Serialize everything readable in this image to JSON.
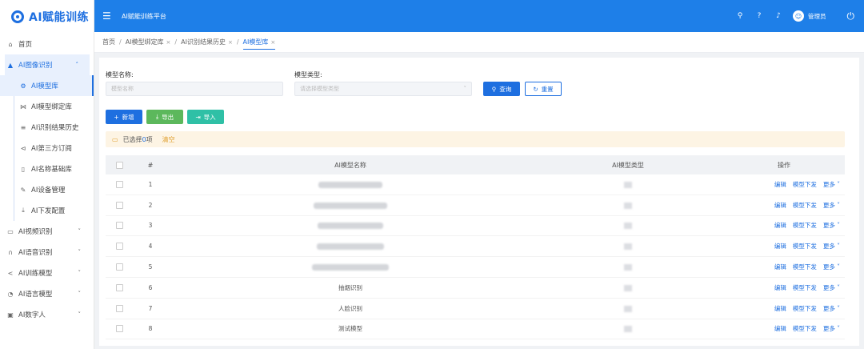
{
  "app": {
    "logo": "AI赋能训练",
    "platform": "AI赋能训练平台"
  },
  "header": {
    "user": "管理员"
  },
  "sidebar": {
    "home": "首页",
    "group": "AI图像识别",
    "subitems": [
      {
        "label": "AI模型库",
        "icon": "gear-icon",
        "active": true
      },
      {
        "label": "AI模型绑定库",
        "icon": "bind-icon"
      },
      {
        "label": "AI识别结果历史",
        "icon": "list-icon"
      },
      {
        "label": "AI第三方订阅",
        "icon": "subscribe-icon"
      },
      {
        "label": "AI名称基础库",
        "icon": "file-icon"
      },
      {
        "label": "AI设备管理",
        "icon": "pen-icon"
      },
      {
        "label": "AI下发配置",
        "icon": "download-icon"
      }
    ],
    "collapsed": [
      {
        "label": "AI视频识别",
        "icon": "video-icon"
      },
      {
        "label": "AI语音识别",
        "icon": "headset-icon"
      },
      {
        "label": "AI训练模型",
        "icon": "share-icon"
      },
      {
        "label": "AI语言模型",
        "icon": "chat-icon"
      },
      {
        "label": "AI数字人",
        "icon": "person-icon"
      }
    ]
  },
  "breadcrumbs": [
    "首页",
    "AI模型绑定库",
    "AI识别结果历史",
    "AI模型库"
  ],
  "filter": {
    "name_label": "模型名称:",
    "name_placeholder": "模型名称",
    "type_label": "模型类型:",
    "type_placeholder": "请选择模型类型",
    "query": "查询",
    "reset": "重置"
  },
  "actions": {
    "add": "新增",
    "export": "导出",
    "import": "导入"
  },
  "selection": {
    "prefix": "已选择",
    "count": "0",
    "suffix": "项",
    "clear": "清空"
  },
  "table": {
    "headers": {
      "index": "#",
      "name": "AI模型名称",
      "type": "AI模型类型",
      "ops": "操作"
    },
    "op_labels": {
      "edit": "编辑",
      "dispatch": "模型下发",
      "more": "更多"
    },
    "rows": [
      {
        "index": "1",
        "name": ""
      },
      {
        "index": "2",
        "name": ""
      },
      {
        "index": "3",
        "name": ""
      },
      {
        "index": "4",
        "name": ""
      },
      {
        "index": "5",
        "name": ""
      },
      {
        "index": "6",
        "name": "抽烟识别"
      },
      {
        "index": "7",
        "name": "人脸识别"
      },
      {
        "index": "8",
        "name": "测试模型"
      }
    ]
  },
  "colors": {
    "primary": "#1e6fe0",
    "header": "#1e7fe8",
    "export": "#5cb85c",
    "import": "#2fc0a6"
  }
}
